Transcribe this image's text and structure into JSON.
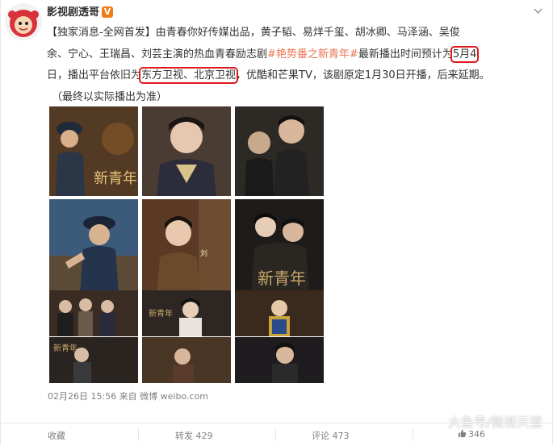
{
  "post": {
    "author": "影视剧透哥",
    "vip_badge": "V",
    "lines": {
      "l1": "【独家消息-全网首发】由青春你好传媒出品，黄子韬、易烊千玺、胡冰卿、马泽涵、吴俊",
      "l2a": "余、宁心、王瑞昌、刘芸主演的热血青春励志剧",
      "l2_hashtag": "#艳势番之新青年#",
      "l2b": "最新播出时间预计为",
      "l2_date": "5月4",
      "l3a": "日，播出平台依旧为",
      "l3_platforms": "东方卫视、北京卫视",
      "l3b": "，优酷和芒果TV，该剧原定1月30日开播，后来延期。",
      "l4": "（最终以实际播出为准）"
    },
    "timestamp": "02月26日 15:56 来自 微博 weibo.com"
  },
  "actions": {
    "collect": "收藏",
    "repost": "转发 429",
    "comment": "评论 473",
    "like": "346"
  },
  "watermark": "大鱼号/微视天堂",
  "colors": {
    "hashtag": "#eb7350",
    "highlight_box": "#e0191d",
    "vip": "#f07c13",
    "meta_text": "#808080"
  },
  "images": {
    "count": 9,
    "poster_caption": "新青年"
  }
}
